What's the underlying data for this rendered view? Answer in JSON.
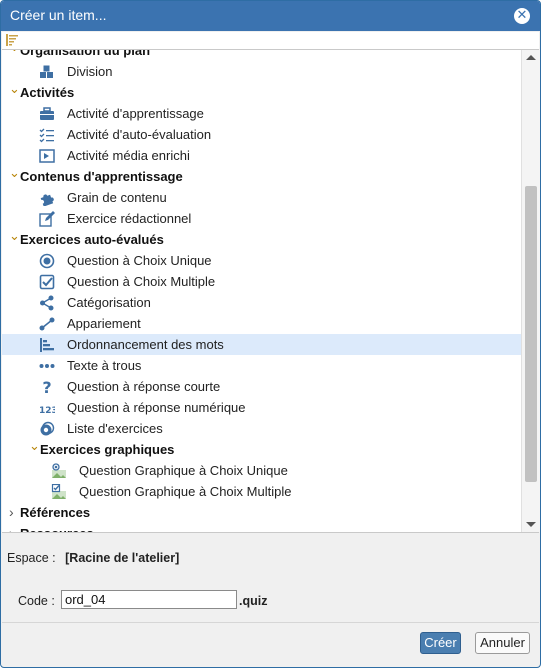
{
  "dialog": {
    "title": "Créer un item..."
  },
  "tree": {
    "items": [
      {
        "level": 0,
        "type": "group",
        "label": "Organisation du plan",
        "expanded": true,
        "icon": "caret-down"
      },
      {
        "level": 1,
        "type": "item",
        "label": "Division",
        "icon": "cubes-icon"
      },
      {
        "level": 0,
        "type": "group",
        "label": "Activités",
        "expanded": true
      },
      {
        "level": 1,
        "type": "item",
        "label": "Activité d'apprentissage",
        "icon": "briefcase-icon"
      },
      {
        "level": 1,
        "type": "item",
        "label": "Activité d'auto-évaluation",
        "icon": "checklist-icon"
      },
      {
        "level": 1,
        "type": "item",
        "label": "Activité média enrichi",
        "icon": "media-play-icon"
      },
      {
        "level": 0,
        "type": "group",
        "label": "Contenus d'apprentissage",
        "expanded": true
      },
      {
        "level": 1,
        "type": "item",
        "label": "Grain de contenu",
        "icon": "puzzle-icon"
      },
      {
        "level": 1,
        "type": "item",
        "label": "Exercice rédactionnel",
        "icon": "pencil-square-icon"
      },
      {
        "level": 0,
        "type": "group",
        "label": "Exercices auto-évalués",
        "expanded": true
      },
      {
        "level": 1,
        "type": "item",
        "label": "Question à Choix Unique",
        "icon": "radio-icon"
      },
      {
        "level": 1,
        "type": "item",
        "label": "Question à Choix Multiple",
        "icon": "checkbox-icon"
      },
      {
        "level": 1,
        "type": "item",
        "label": "Catégorisation",
        "icon": "share-icon"
      },
      {
        "level": 1,
        "type": "item",
        "label": "Appariement",
        "icon": "link-nodes-icon"
      },
      {
        "level": 1,
        "type": "item",
        "label": "Ordonnancement des mots",
        "icon": "sort-bars-icon",
        "selected": true
      },
      {
        "level": 1,
        "type": "item",
        "label": "Texte à trous",
        "icon": "dots-icon"
      },
      {
        "level": 1,
        "type": "item",
        "label": "Question à réponse courte",
        "icon": "question-icon"
      },
      {
        "level": 1,
        "type": "item",
        "label": "Question à réponse numérique",
        "icon": "numbers-icon"
      },
      {
        "level": 1,
        "type": "item",
        "label": "Liste d'exercices",
        "icon": "layers-icon"
      },
      {
        "level": 1,
        "type": "group",
        "label": "Exercices graphiques",
        "expanded": true
      },
      {
        "level": 2,
        "type": "item",
        "label": "Question Graphique à Choix Unique",
        "icon": "image-radio-icon"
      },
      {
        "level": 2,
        "type": "item",
        "label": "Question Graphique à Choix Multiple",
        "icon": "image-check-icon"
      },
      {
        "level": 0,
        "type": "group",
        "label": "Références",
        "expanded": false
      },
      {
        "level": 0,
        "type": "group",
        "label": "Ressources",
        "expanded": false
      }
    ]
  },
  "space": {
    "label": "Espace :",
    "value": "[Racine de l'atelier]"
  },
  "code": {
    "label": "Code :",
    "value": "ord_04",
    "suffix": ".quiz"
  },
  "buttons": {
    "create": "Créer",
    "cancel": "Annuler"
  },
  "colors": {
    "titlebar": "#3b73b0",
    "icon": "#3e6fa3",
    "selected_row": "#dceafb",
    "caret": "#b8860b"
  }
}
